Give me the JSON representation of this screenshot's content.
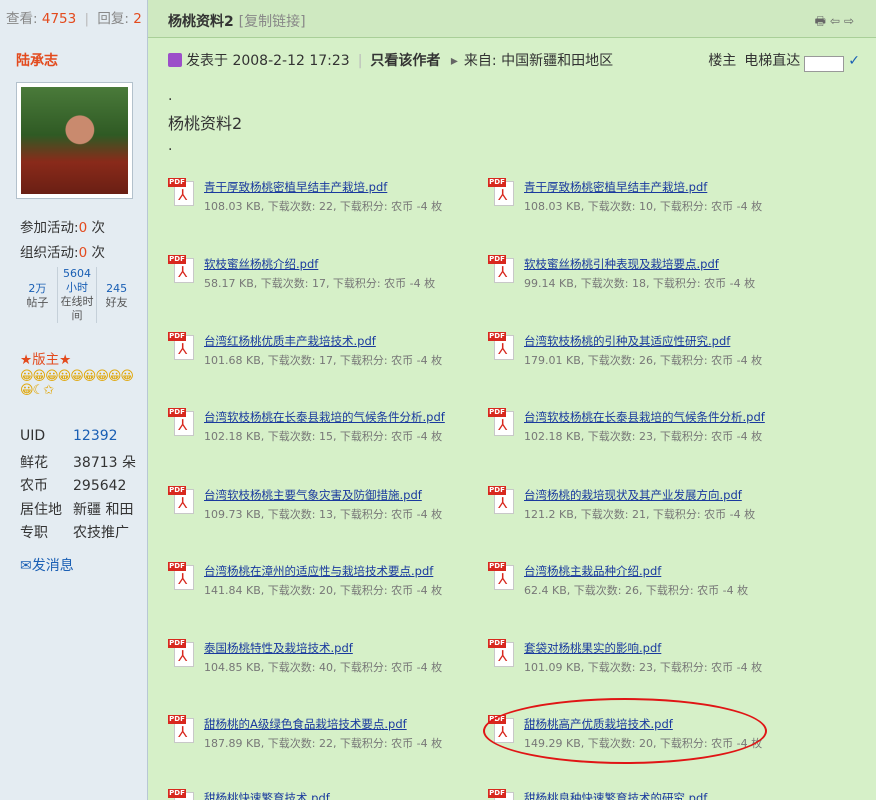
{
  "stats": {
    "views_label": "查看:",
    "views": "4753",
    "sep": "|",
    "replies_label": "回复:",
    "replies": "2"
  },
  "thread": {
    "title": "杨桃资料2",
    "copy_link": "[复制链接]"
  },
  "top_icons": "🖶⇦⇨",
  "author": {
    "name": "陆承志",
    "activities_joined_label": "参加活动:",
    "activities_joined": "0",
    "activities_joined_unit": "次",
    "activities_organized_label": "组织活动:",
    "activities_organized": "0",
    "activities_organized_unit": "次",
    "mini_stats": [
      {
        "value": "2万",
        "label": "帖子"
      },
      {
        "value": "5604 小时",
        "label": "在线时间"
      },
      {
        "value": "245",
        "label": "好友"
      }
    ],
    "moderator": "★版主★",
    "emoticons": "😀😀😀😀😀😀😀😀😀😀☾✩",
    "profile": [
      {
        "key": "UID",
        "value": "12392",
        "link": true
      },
      {
        "key": "鲜花",
        "value": "38713 朵",
        "link": false
      },
      {
        "key": "农币",
        "value": "295642",
        "link": false
      },
      {
        "key": "居住地",
        "value": "新疆 和田",
        "link": false
      },
      {
        "key": "专职",
        "value": "农技推广",
        "link": false
      }
    ],
    "send_message": "✉发消息"
  },
  "post": {
    "posted": "发表于 2008-2-12 17:23",
    "sep": "|",
    "only_author": "只看该作者",
    "arrow": "▸",
    "from": "来自:  中国新疆和田地区",
    "floor": "楼主",
    "elevator": "电梯直达",
    "go": "✓",
    "dot": ".",
    "body_title": "杨桃资料2"
  },
  "attachments": [
    {
      "name": "青干厚致杨桃密植早结丰产栽培.pdf",
      "meta": "108.03 KB, 下载次数: 22, 下载积分: 农币 -4 枚"
    },
    {
      "name": "青干厚致杨桃密植早结丰产栽培.pdf",
      "meta": "108.03 KB, 下载次数: 10, 下载积分: 农币 -4 枚"
    },
    {
      "name": "软枝蜜丝杨桃介绍.pdf",
      "meta": "58.17 KB, 下载次数: 17, 下载积分: 农币 -4 枚"
    },
    {
      "name": "软枝蜜丝杨桃引种表现及栽培要点.pdf",
      "meta": "99.14 KB, 下载次数: 18, 下载积分: 农币 -4 枚"
    },
    {
      "name": "台湾红杨桃优质丰产栽培技术.pdf",
      "meta": "101.68 KB, 下载次数: 17, 下载积分: 农币 -4 枚"
    },
    {
      "name": "台湾软枝杨桃的引种及其适应性研究.pdf",
      "meta": "179.01 KB, 下载次数: 26, 下载积分: 农币 -4 枚"
    },
    {
      "name": "台湾软枝杨桃在长泰县栽培的气候条件分析.pdf",
      "meta": "102.18 KB, 下载次数: 15, 下载积分: 农币 -4 枚"
    },
    {
      "name": "台湾软枝杨桃在长泰县栽培的气候条件分析.pdf",
      "meta": "102.18 KB, 下载次数: 23, 下载积分: 农币 -4 枚"
    },
    {
      "name": "台湾软枝杨桃主要气象灾害及防御措施.pdf",
      "meta": "109.73 KB, 下载次数: 13, 下载积分: 农币 -4 枚"
    },
    {
      "name": "台湾杨桃的栽培现状及其产业发展方向.pdf",
      "meta": "121.2 KB, 下载次数: 21, 下载积分: 农币 -4 枚"
    },
    {
      "name": "台湾杨桃在漳州的适应性与栽培技术要点.pdf",
      "meta": "141.84 KB, 下载次数: 20, 下载积分: 农币 -4 枚"
    },
    {
      "name": "台湾杨桃主栽品种介绍.pdf",
      "meta": "62.4 KB, 下载次数: 26, 下载积分: 农币 -4 枚"
    },
    {
      "name": "泰国杨桃特性及栽培技术.pdf",
      "meta": "104.85 KB, 下载次数: 40, 下载积分: 农币 -4 枚"
    },
    {
      "name": "套袋对杨桃果实的影响.pdf",
      "meta": "101.09 KB, 下载次数: 23, 下载积分: 农币 -4 枚"
    },
    {
      "name": "甜杨桃的A级绿色食品栽培技术要点.pdf",
      "meta": "187.89 KB, 下载次数: 22, 下载积分: 农币 -4 枚"
    },
    {
      "name": "甜杨桃高产优质栽培技术.pdf",
      "meta": "149.29 KB, 下载次数: 20, 下载积分: 农币 -4 枚"
    },
    {
      "name": "甜杨桃快速繁育技术.pdf",
      "meta": ""
    },
    {
      "name": "甜杨桃良种快速繁育技术的研究.pdf",
      "meta": ""
    }
  ],
  "pdf_icon": {
    "tag": "PDF",
    "symbol": "⅄"
  },
  "colors": {
    "accent_red": "#e34a1d",
    "link_blue": "#1a3a9e",
    "highlight": "#e01515",
    "bg_green": "#d6f0c8"
  }
}
